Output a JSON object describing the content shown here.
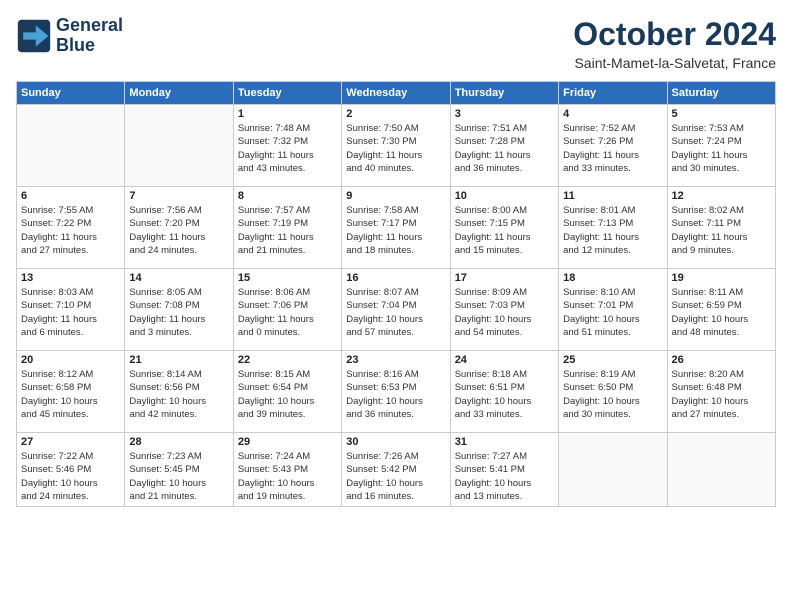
{
  "logo": {
    "line1": "General",
    "line2": "Blue"
  },
  "title": "October 2024",
  "location": "Saint-Mamet-la-Salvetat, France",
  "weekdays": [
    "Sunday",
    "Monday",
    "Tuesday",
    "Wednesday",
    "Thursday",
    "Friday",
    "Saturday"
  ],
  "weeks": [
    [
      {
        "day": "",
        "info": ""
      },
      {
        "day": "",
        "info": ""
      },
      {
        "day": "1",
        "info": "Sunrise: 7:48 AM\nSunset: 7:32 PM\nDaylight: 11 hours\nand 43 minutes."
      },
      {
        "day": "2",
        "info": "Sunrise: 7:50 AM\nSunset: 7:30 PM\nDaylight: 11 hours\nand 40 minutes."
      },
      {
        "day": "3",
        "info": "Sunrise: 7:51 AM\nSunset: 7:28 PM\nDaylight: 11 hours\nand 36 minutes."
      },
      {
        "day": "4",
        "info": "Sunrise: 7:52 AM\nSunset: 7:26 PM\nDaylight: 11 hours\nand 33 minutes."
      },
      {
        "day": "5",
        "info": "Sunrise: 7:53 AM\nSunset: 7:24 PM\nDaylight: 11 hours\nand 30 minutes."
      }
    ],
    [
      {
        "day": "6",
        "info": "Sunrise: 7:55 AM\nSunset: 7:22 PM\nDaylight: 11 hours\nand 27 minutes."
      },
      {
        "day": "7",
        "info": "Sunrise: 7:56 AM\nSunset: 7:20 PM\nDaylight: 11 hours\nand 24 minutes."
      },
      {
        "day": "8",
        "info": "Sunrise: 7:57 AM\nSunset: 7:19 PM\nDaylight: 11 hours\nand 21 minutes."
      },
      {
        "day": "9",
        "info": "Sunrise: 7:58 AM\nSunset: 7:17 PM\nDaylight: 11 hours\nand 18 minutes."
      },
      {
        "day": "10",
        "info": "Sunrise: 8:00 AM\nSunset: 7:15 PM\nDaylight: 11 hours\nand 15 minutes."
      },
      {
        "day": "11",
        "info": "Sunrise: 8:01 AM\nSunset: 7:13 PM\nDaylight: 11 hours\nand 12 minutes."
      },
      {
        "day": "12",
        "info": "Sunrise: 8:02 AM\nSunset: 7:11 PM\nDaylight: 11 hours\nand 9 minutes."
      }
    ],
    [
      {
        "day": "13",
        "info": "Sunrise: 8:03 AM\nSunset: 7:10 PM\nDaylight: 11 hours\nand 6 minutes."
      },
      {
        "day": "14",
        "info": "Sunrise: 8:05 AM\nSunset: 7:08 PM\nDaylight: 11 hours\nand 3 minutes."
      },
      {
        "day": "15",
        "info": "Sunrise: 8:06 AM\nSunset: 7:06 PM\nDaylight: 11 hours\nand 0 minutes."
      },
      {
        "day": "16",
        "info": "Sunrise: 8:07 AM\nSunset: 7:04 PM\nDaylight: 10 hours\nand 57 minutes."
      },
      {
        "day": "17",
        "info": "Sunrise: 8:09 AM\nSunset: 7:03 PM\nDaylight: 10 hours\nand 54 minutes."
      },
      {
        "day": "18",
        "info": "Sunrise: 8:10 AM\nSunset: 7:01 PM\nDaylight: 10 hours\nand 51 minutes."
      },
      {
        "day": "19",
        "info": "Sunrise: 8:11 AM\nSunset: 6:59 PM\nDaylight: 10 hours\nand 48 minutes."
      }
    ],
    [
      {
        "day": "20",
        "info": "Sunrise: 8:12 AM\nSunset: 6:58 PM\nDaylight: 10 hours\nand 45 minutes."
      },
      {
        "day": "21",
        "info": "Sunrise: 8:14 AM\nSunset: 6:56 PM\nDaylight: 10 hours\nand 42 minutes."
      },
      {
        "day": "22",
        "info": "Sunrise: 8:15 AM\nSunset: 6:54 PM\nDaylight: 10 hours\nand 39 minutes."
      },
      {
        "day": "23",
        "info": "Sunrise: 8:16 AM\nSunset: 6:53 PM\nDaylight: 10 hours\nand 36 minutes."
      },
      {
        "day": "24",
        "info": "Sunrise: 8:18 AM\nSunset: 6:51 PM\nDaylight: 10 hours\nand 33 minutes."
      },
      {
        "day": "25",
        "info": "Sunrise: 8:19 AM\nSunset: 6:50 PM\nDaylight: 10 hours\nand 30 minutes."
      },
      {
        "day": "26",
        "info": "Sunrise: 8:20 AM\nSunset: 6:48 PM\nDaylight: 10 hours\nand 27 minutes."
      }
    ],
    [
      {
        "day": "27",
        "info": "Sunrise: 7:22 AM\nSunset: 5:46 PM\nDaylight: 10 hours\nand 24 minutes."
      },
      {
        "day": "28",
        "info": "Sunrise: 7:23 AM\nSunset: 5:45 PM\nDaylight: 10 hours\nand 21 minutes."
      },
      {
        "day": "29",
        "info": "Sunrise: 7:24 AM\nSunset: 5:43 PM\nDaylight: 10 hours\nand 19 minutes."
      },
      {
        "day": "30",
        "info": "Sunrise: 7:26 AM\nSunset: 5:42 PM\nDaylight: 10 hours\nand 16 minutes."
      },
      {
        "day": "31",
        "info": "Sunrise: 7:27 AM\nSunset: 5:41 PM\nDaylight: 10 hours\nand 13 minutes."
      },
      {
        "day": "",
        "info": ""
      },
      {
        "day": "",
        "info": ""
      }
    ]
  ]
}
